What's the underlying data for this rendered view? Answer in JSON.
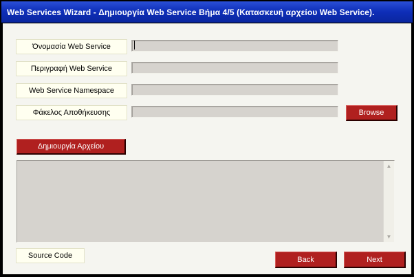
{
  "window": {
    "title": "Web Services Wizard - Δημιουργία  Web Service Βήμα 4/5   (Κατασκευή αρχείου Web Service)."
  },
  "form": {
    "fields": [
      {
        "label": "Όνομασία Web Service",
        "value": ""
      },
      {
        "label": "Περιγραφή Web Service",
        "value": ""
      },
      {
        "label": "Web Service Namespace",
        "value": ""
      },
      {
        "label": "Φάκελος Αποθήκευσης",
        "value": ""
      }
    ],
    "browse_label": "Browse",
    "create_file_label": "Δημιουργία Αρχείου"
  },
  "output": {
    "content": "",
    "source_code_label": "Source Code"
  },
  "nav": {
    "back_label": "Back",
    "next_label": "Next"
  },
  "icons": {
    "scroll_up": "scroll-up-arrow-icon",
    "scroll_down": "scroll-down-arrow-icon"
  },
  "colors": {
    "titlebar": "#0e2eb8",
    "button": "#b0201f",
    "label_bg": "#fffff0",
    "field_bg": "#d6d3ce"
  }
}
